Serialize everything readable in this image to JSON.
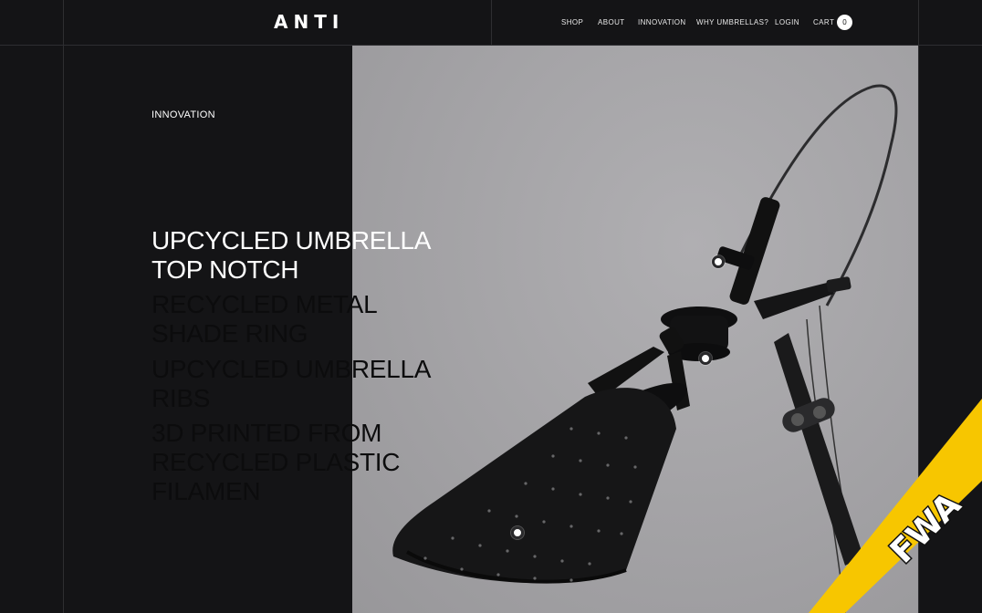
{
  "header": {
    "logo": "ANTI",
    "nav": [
      {
        "label": "SHOP"
      },
      {
        "label": "ABOUT"
      },
      {
        "label": "INNOVATION"
      },
      {
        "label": "WHY UMBRELLAS?"
      },
      {
        "label": "LOGIN"
      }
    ],
    "cart_label": "CART",
    "cart_count": "0"
  },
  "hero": {
    "section_label": "INNOVATION",
    "features": [
      {
        "text": "UPCYCLED UMBRELLA\nTOP NOTCH",
        "active": true
      },
      {
        "text": "RECYCLED METAL\nSHADE RING",
        "active": false
      },
      {
        "text": "UPCYCLED UMBRELLA\nRIBS",
        "active": false
      },
      {
        "text": "3D PRINTED FROM\nRECYCLED PLASTIC\nFILAMEN",
        "active": false
      }
    ]
  },
  "badge": {
    "text": "FWA",
    "color": "#f7c600"
  },
  "colors": {
    "background": "#141416",
    "photo_bg": "#a3a2a5",
    "text": "#ffffff"
  }
}
